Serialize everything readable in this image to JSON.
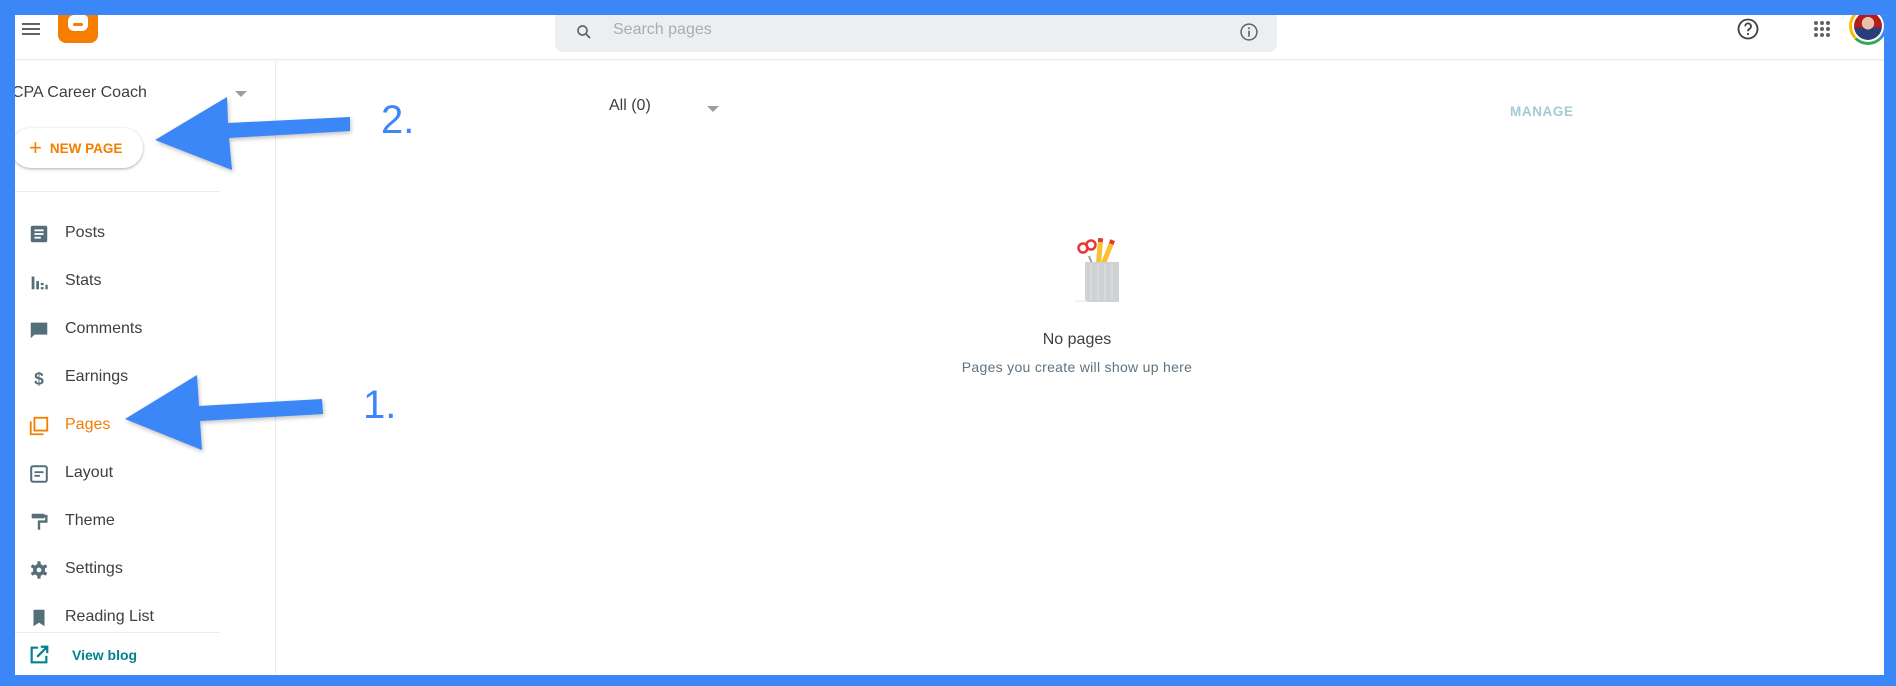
{
  "header": {
    "menu_icon": "hamburger-menu-icon",
    "logo": "blogger-logo",
    "search": {
      "placeholder": "Search pages",
      "value": ""
    },
    "info_icon": "info-icon",
    "help_icon": "help-icon",
    "apps_icon": "apps-grid-icon",
    "avatar": "account-avatar"
  },
  "sidebar": {
    "blog_name": "CPA Career Coach",
    "new_page_label": "NEW PAGE",
    "items": [
      {
        "label": "Posts",
        "icon": "posts-icon"
      },
      {
        "label": "Stats",
        "icon": "stats-icon"
      },
      {
        "label": "Comments",
        "icon": "comment-icon"
      },
      {
        "label": "Earnings",
        "icon": "dollar-icon"
      },
      {
        "label": "Pages",
        "icon": "pages-icon",
        "active": true
      },
      {
        "label": "Layout",
        "icon": "layout-icon"
      },
      {
        "label": "Theme",
        "icon": "paint-roller-icon"
      },
      {
        "label": "Settings",
        "icon": "gear-icon"
      },
      {
        "label": "Reading List",
        "icon": "bookmark-icon"
      }
    ],
    "view_blog_label": "View blog"
  },
  "content": {
    "filter_label": "All (0)",
    "manage_label": "MANAGE",
    "empty_title": "No pages",
    "empty_subtitle": "Pages you create will show up here"
  },
  "annotations": [
    {
      "label": "1.",
      "target": "Pages"
    },
    {
      "label": "2.",
      "target": "NEW PAGE"
    }
  ],
  "colors": {
    "accent": "#f57d00",
    "annotation": "#3b87f7",
    "link": "#00838f",
    "icon": "#546e7a"
  }
}
